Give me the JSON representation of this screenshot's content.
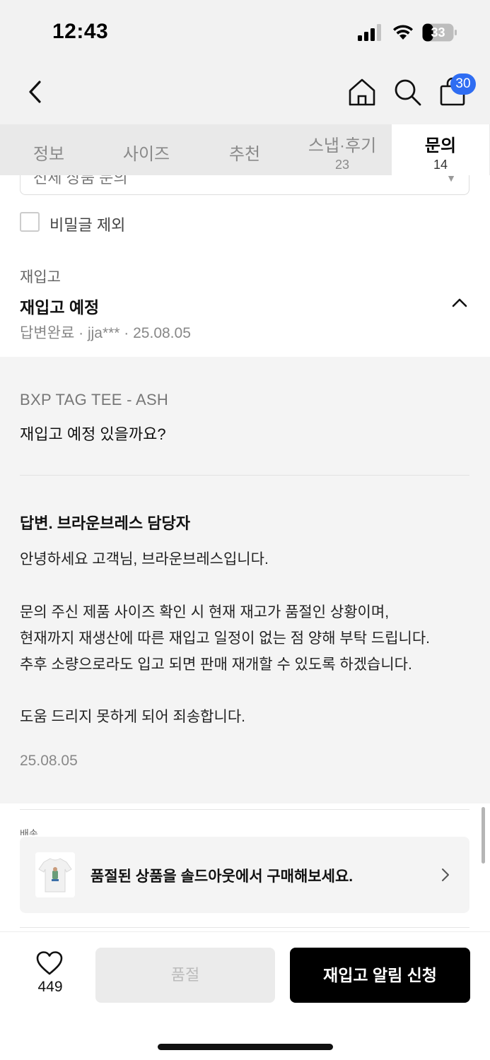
{
  "status_bar": {
    "time": "12:43",
    "battery": "33"
  },
  "nav": {
    "cart_count": "30"
  },
  "tabs": [
    {
      "label": "정보",
      "count": ""
    },
    {
      "label": "사이즈",
      "count": ""
    },
    {
      "label": "추천",
      "count": ""
    },
    {
      "label": "스냅·후기",
      "count": "23"
    },
    {
      "label": "문의",
      "count": "14"
    }
  ],
  "filter": {
    "selected": "전체 상품 문의"
  },
  "exclude_secret": {
    "label": "비밀글 제외"
  },
  "inquiry": {
    "category": "재입고",
    "title": "재입고 예정",
    "meta": "답변완료 · jja*** · 25.08.05",
    "product": "BXP TAG TEE - ASH",
    "question": "재입고 예정 있을까요?",
    "answer_title": "답변. 브라운브레스 담당자",
    "answer_lines": [
      "안녕하세요 고객님, 브라운브레스입니다.",
      "문의 주신 제품 사이즈 확인 시 현재 재고가 품절인 상황이며,",
      "현재까지 재생산에 따른 재입고 일정이 없는 점 양해 부탁 드립니다.",
      "추후 소량으로라도 입고 되면 판매 재개할 수 있도록 하겠습니다.",
      "도움 드리지 못하게 되어 죄송합니다."
    ],
    "answer_date": "25.08.05"
  },
  "next_item_partial": "배송",
  "soldout_banner": {
    "text": "품절된 상품을 솔드아웃에서 구매해보세요."
  },
  "bottom": {
    "like_count": "449",
    "soldout_label": "품절",
    "restock_label": "재입고 알림 신청"
  }
}
